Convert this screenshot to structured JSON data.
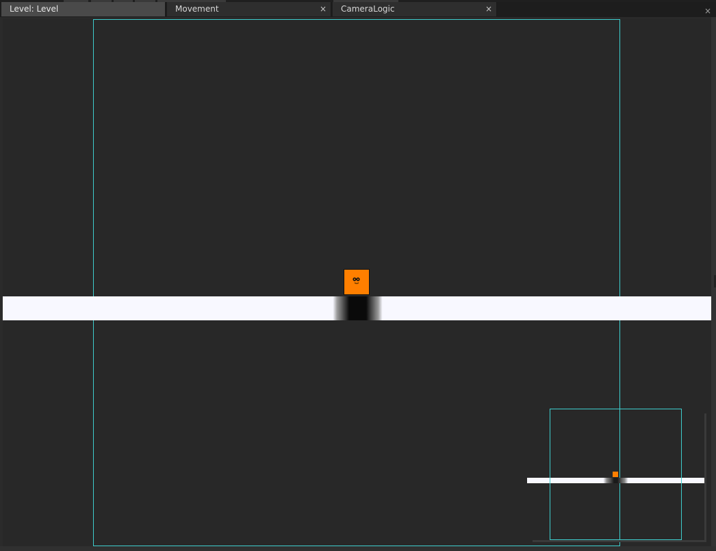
{
  "tabs": [
    {
      "label": "Level: Level",
      "active": true,
      "closable": false
    },
    {
      "label": "Movement",
      "active": false,
      "closable": true
    },
    {
      "label": "CameraLogic",
      "active": false,
      "closable": true
    }
  ],
  "close_glyph": "×",
  "colors": {
    "viewport_bg": "#282828",
    "camera_bounds": "#3ecfcf",
    "floor": "#f8f8ff",
    "player": "#ff7f00"
  },
  "icons": {
    "tab_close": "close-icon",
    "panel_close": "close-icon",
    "player": "player-sprite"
  }
}
